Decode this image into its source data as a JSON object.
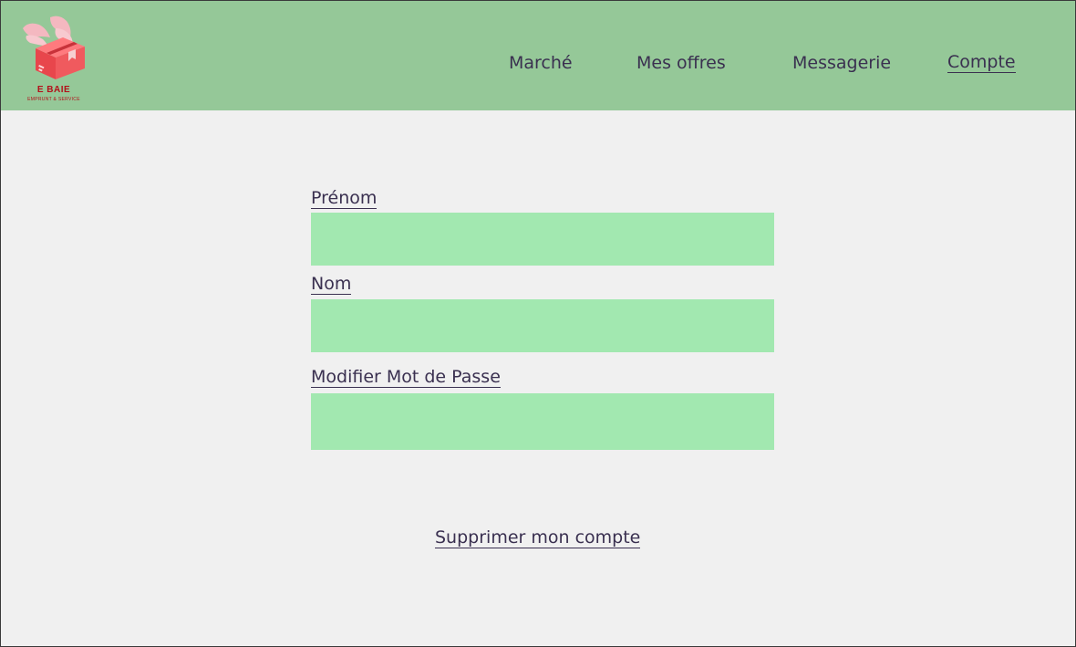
{
  "brand": {
    "name": "E BAIE",
    "tagline": "EMPRUNT & SERVICE",
    "logo_icon": "winged-box-icon",
    "colors": {
      "box": "#f05a5e",
      "wings": "#f4b8c0",
      "text": "#b3101a"
    }
  },
  "nav": {
    "items": [
      {
        "label": "Marché"
      },
      {
        "label": "Mes offres"
      },
      {
        "label": "Messagerie"
      },
      {
        "label": "Compte",
        "active": true
      }
    ]
  },
  "form": {
    "prenom": {
      "label": "Prénom",
      "value": ""
    },
    "nom": {
      "label": "Nom",
      "value": ""
    },
    "password": {
      "label": "Modifier Mot de Passe",
      "value": ""
    }
  },
  "actions": {
    "delete_account": "Supprimer mon compte"
  },
  "colors": {
    "header_bg": "#95c898",
    "page_bg": "#f0f0f0",
    "input_bg": "#a2e8b0",
    "text": "#3a3050"
  }
}
